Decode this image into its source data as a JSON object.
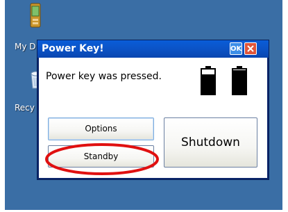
{
  "desktop": {
    "icons": [
      {
        "label": "My D",
        "icon": "mobile-device-icon"
      },
      {
        "label": "Recy",
        "icon": "recycle-bin-icon"
      }
    ]
  },
  "dialog": {
    "title": "Power Key!",
    "ok_label": "OK",
    "message": "Power key was pressed.",
    "buttons": {
      "options": "Options",
      "standby": "Standby",
      "shutdown": "Shutdown"
    }
  },
  "colors": {
    "desktop_background": "#3a6ea5",
    "titlebar": "#0b54c8",
    "close_button": "#e0553a",
    "highlight": "#e01010"
  }
}
